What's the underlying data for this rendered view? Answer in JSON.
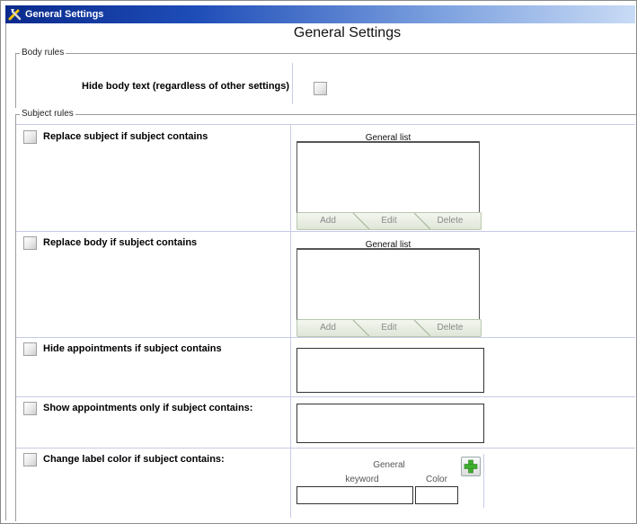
{
  "window": {
    "title": "General Settings"
  },
  "heading": "General Settings",
  "body_rules": {
    "legend": "Body rules",
    "hide_body_text": {
      "label": "Hide body text (regardless of other settings)",
      "checked": false
    }
  },
  "subject_rules": {
    "legend": "Subject rules",
    "replace_subject": {
      "label": "Replace subject if subject contains",
      "checked": false,
      "list_caption": "General list",
      "buttons": {
        "add": "Add",
        "edit": "Edit",
        "delete": "Delete"
      }
    },
    "replace_body": {
      "label": "Replace body if subject contains",
      "checked": false,
      "list_caption": "General list",
      "buttons": {
        "add": "Add",
        "edit": "Edit",
        "delete": "Delete"
      }
    },
    "hide_appointments": {
      "label": "Hide appointments if subject contains",
      "checked": false,
      "value": ""
    },
    "show_appointments_only": {
      "label": "Show appointments only if subject contains:",
      "checked": false,
      "value": ""
    },
    "change_label_color": {
      "label": "Change label color if subject contains:",
      "checked": false,
      "general_caption": "General",
      "keyword_caption": "keyword",
      "color_caption": "Color",
      "keyword_value": "",
      "color_value": ""
    }
  },
  "colors": {
    "title_bar": "#0a2a8c",
    "add_icon": "#3fae2f"
  }
}
